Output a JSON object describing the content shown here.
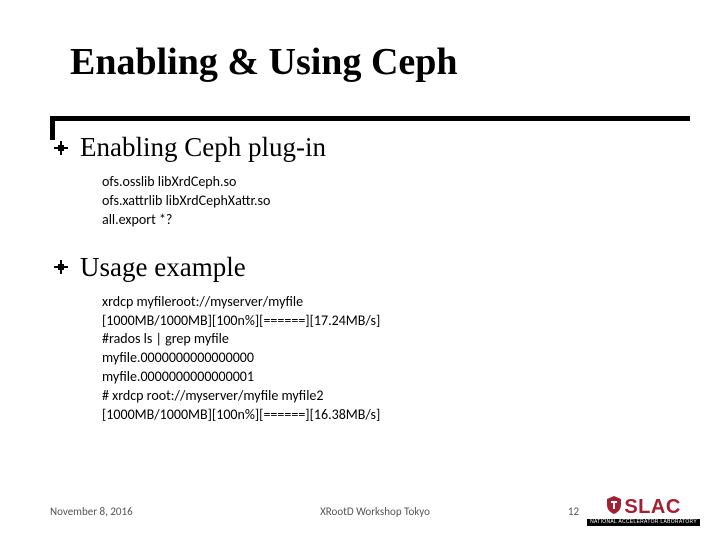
{
  "title": "Enabling & Using Ceph",
  "sections": [
    {
      "heading": "Enabling Ceph plug-in",
      "code": "ofs.osslib libXrdCeph.so\nofs.xattrlib libXrdCephXattr.so\nall.export *?"
    },
    {
      "heading": "Usage example",
      "code": "xrdcp myfileroot://myserver/myfile\n[1000MB/1000MB][100n%][======][17.24MB/s]\n#rados ls | grep myfile\nmyfile.0000000000000000\nmyfile.0000000000000001\n# xrdcp root://myserver/myfile myfile2\n[1000MB/1000MB][100n%][======][16.38MB/s]"
    }
  ],
  "footer": {
    "date": "November 8, 2016",
    "center": "XRootD Workshop Tokyo",
    "page": "12",
    "logo_text": "SLAC",
    "logo_sub": "NATIONAL ACCELERATOR LABORATORY"
  }
}
